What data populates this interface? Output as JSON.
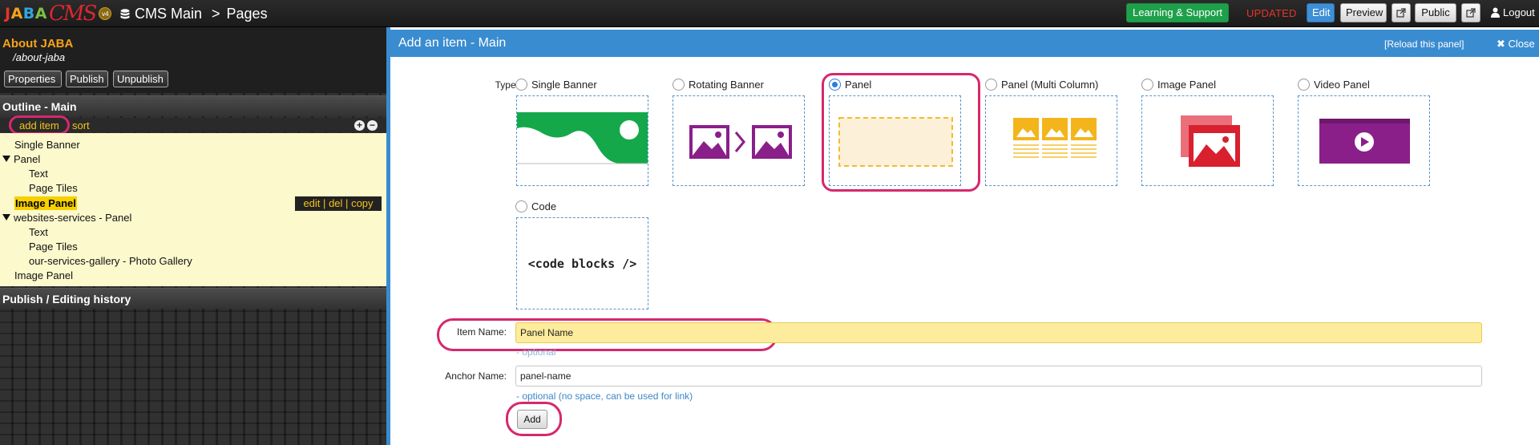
{
  "app": {
    "logo_text": "JABA",
    "logo_cms": "CMS",
    "logo_version": "v4",
    "breadcrumb": {
      "root": "CMS Main",
      "separator": ">",
      "current": "Pages"
    }
  },
  "topbar": {
    "learning_label": "Learning & Support",
    "status_text": "UPDATED",
    "edit_label": "Edit",
    "preview_label": "Preview",
    "public_label": "Public",
    "logout_label": "Logout",
    "colors": {
      "learning": "#1ea04a",
      "status": "#e8332a",
      "edit": "#3f8fd6"
    }
  },
  "sidebar": {
    "page_title": "About JABA",
    "page_path": "/about-jaba",
    "buttons": {
      "properties": "Properties",
      "publish": "Publish",
      "unpublish": "Unpublish"
    },
    "outline_title": "Outline - Main",
    "add_item_label": "add item",
    "sort_label": "sort",
    "expand_symbol": "+",
    "collapse_symbol": "−",
    "items": [
      {
        "label": "Single Banner"
      },
      {
        "label": "Panel"
      },
      {
        "label": "Text"
      },
      {
        "label": "Page Tiles"
      },
      {
        "label": "Image Panel"
      },
      {
        "label": "websites-services - Panel"
      },
      {
        "label": "Text"
      },
      {
        "label": "Page Tiles"
      },
      {
        "label": "our-services-gallery - Photo Gallery"
      },
      {
        "label": "Image Panel"
      }
    ],
    "row_actions": {
      "edit": "edit",
      "del": "del",
      "copy": "copy",
      "divider": "|"
    },
    "history_title": "Publish / Editing history"
  },
  "dialog": {
    "title": "Add an item - Main",
    "reload_label": "[Reload this panel]",
    "close_label": "Close",
    "type_label": "Type:",
    "types": [
      {
        "label": "Single Banner",
        "selected": false,
        "icon": "single-banner-icon"
      },
      {
        "label": "Rotating Banner",
        "selected": false,
        "icon": "rotating-banner-icon"
      },
      {
        "label": "Panel",
        "selected": true,
        "icon": "panel-icon"
      },
      {
        "label": "Panel (Multi Column)",
        "selected": false,
        "icon": "panel-multi-column-icon"
      },
      {
        "label": "Image Panel",
        "selected": false,
        "icon": "image-panel-icon"
      },
      {
        "label": "Video Panel",
        "selected": false,
        "icon": "video-panel-icon"
      },
      {
        "label": "Code",
        "selected": false,
        "icon": "code-icon"
      }
    ],
    "code_preview_text": "<code blocks />",
    "item_name_label": "Item Name:",
    "item_name_value": "Panel Name",
    "item_name_hint": "- optional",
    "anchor_name_label": "Anchor Name:",
    "anchor_name_value": "panel-name",
    "anchor_name_hint": "- optional (no space, can be used for link)",
    "add_label": "Add",
    "colors": {
      "header": "#3a8cd0",
      "highlight": "#d6286d",
      "item_name_bg": "#fdec9c"
    }
  }
}
